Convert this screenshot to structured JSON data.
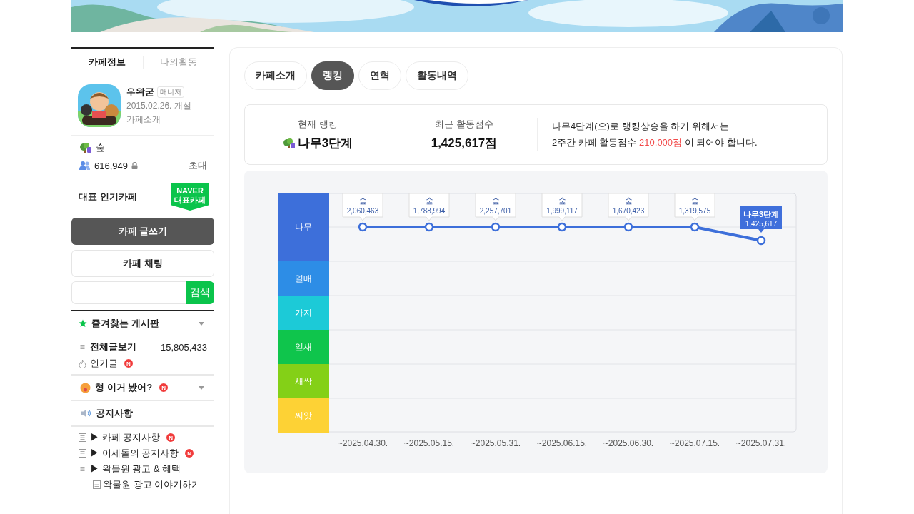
{
  "sidebar": {
    "tabs": [
      {
        "label": "카페정보",
        "selected": true
      },
      {
        "label": "나의활동",
        "selected": false
      }
    ],
    "profile": {
      "name": "우왁굳",
      "role": "매니저",
      "founded": "2015.02.26. 개설",
      "intro_link": "카페소개"
    },
    "stats": {
      "rank": "숲",
      "members": "616,949",
      "invite": "초대"
    },
    "featured": {
      "label": "대표 인기카페",
      "badge_top": "NAVER",
      "badge_bottom": "대표카페"
    },
    "write_button": "카페 글쓰기",
    "chat_button": "카페 채팅",
    "search": {
      "button": "검색"
    },
    "favorites": {
      "title": "즐겨찾는 게시판"
    },
    "boards": [
      {
        "kind": "all",
        "label": "전체글보기",
        "count": "15,805,433"
      },
      {
        "kind": "popular",
        "label": "인기글",
        "badge": "N"
      }
    ],
    "menus": [
      {
        "kind": "group",
        "label": "형 이거 봤어?",
        "badge": "N"
      },
      {
        "kind": "section",
        "label": "공지사항"
      }
    ],
    "notice_boards": [
      {
        "label": "▶ 카페 공지사항",
        "badge": "N"
      },
      {
        "label": "▶ 이세돌의 공지사항",
        "badge": "N"
      },
      {
        "label": "▶ 왁물원 광고 & 혜택",
        "children": [
          {
            "label": "왁물원 광고 이야기하기"
          }
        ]
      }
    ]
  },
  "tabs": [
    {
      "label": "카페소개",
      "selected": false
    },
    {
      "label": "랭킹",
      "selected": true
    },
    {
      "label": "연혁",
      "selected": false
    },
    {
      "label": "활동내역",
      "selected": false
    }
  ],
  "summary": {
    "current_label": "현재 랭킹",
    "current_rank": "나무3단계",
    "score_label": "최근 활동점수",
    "score": "1,425,617점",
    "note_line1": "나무4단계(으)로 랭킹상승을 하기 위해서는",
    "note_before": "2주간 카페 활동점수",
    "note_highlight": "210,000점",
    "note_after": "이 되어야 합니다."
  },
  "rank_chart": {
    "levels": [
      {
        "name": "나무",
        "color": "#3d6fda",
        "selected": true
      },
      {
        "name": "열매",
        "color": "#2d8de6",
        "selected": false
      },
      {
        "name": "가지",
        "color": "#1ccad7",
        "selected": false
      },
      {
        "name": "잎새",
        "color": "#0fc54c",
        "selected": false
      },
      {
        "name": "새싹",
        "color": "#84d017",
        "selected": false
      },
      {
        "name": "씨앗",
        "color": "#fdd235",
        "selected": false
      }
    ],
    "points": [
      {
        "kind": "past",
        "rank": "숲",
        "score": "2,060,463"
      },
      {
        "kind": "past",
        "rank": "숲",
        "score": "1,788,994"
      },
      {
        "kind": "past",
        "rank": "숲",
        "score": "2,257,701"
      },
      {
        "kind": "past",
        "rank": "숲",
        "score": "1,999,117"
      },
      {
        "kind": "past",
        "rank": "숲",
        "score": "1,670,423"
      },
      {
        "kind": "past",
        "rank": "숲",
        "score": "1,319,575"
      },
      {
        "kind": "current",
        "rank": "나무3단계",
        "score": "1,425,617"
      }
    ],
    "dates": [
      "~2025.04.30.",
      "~2025.05.15.",
      "~2025.05.31.",
      "~2025.06.15.",
      "~2025.06.30.",
      "~2025.07.15.",
      "~2025.07.31."
    ]
  }
}
